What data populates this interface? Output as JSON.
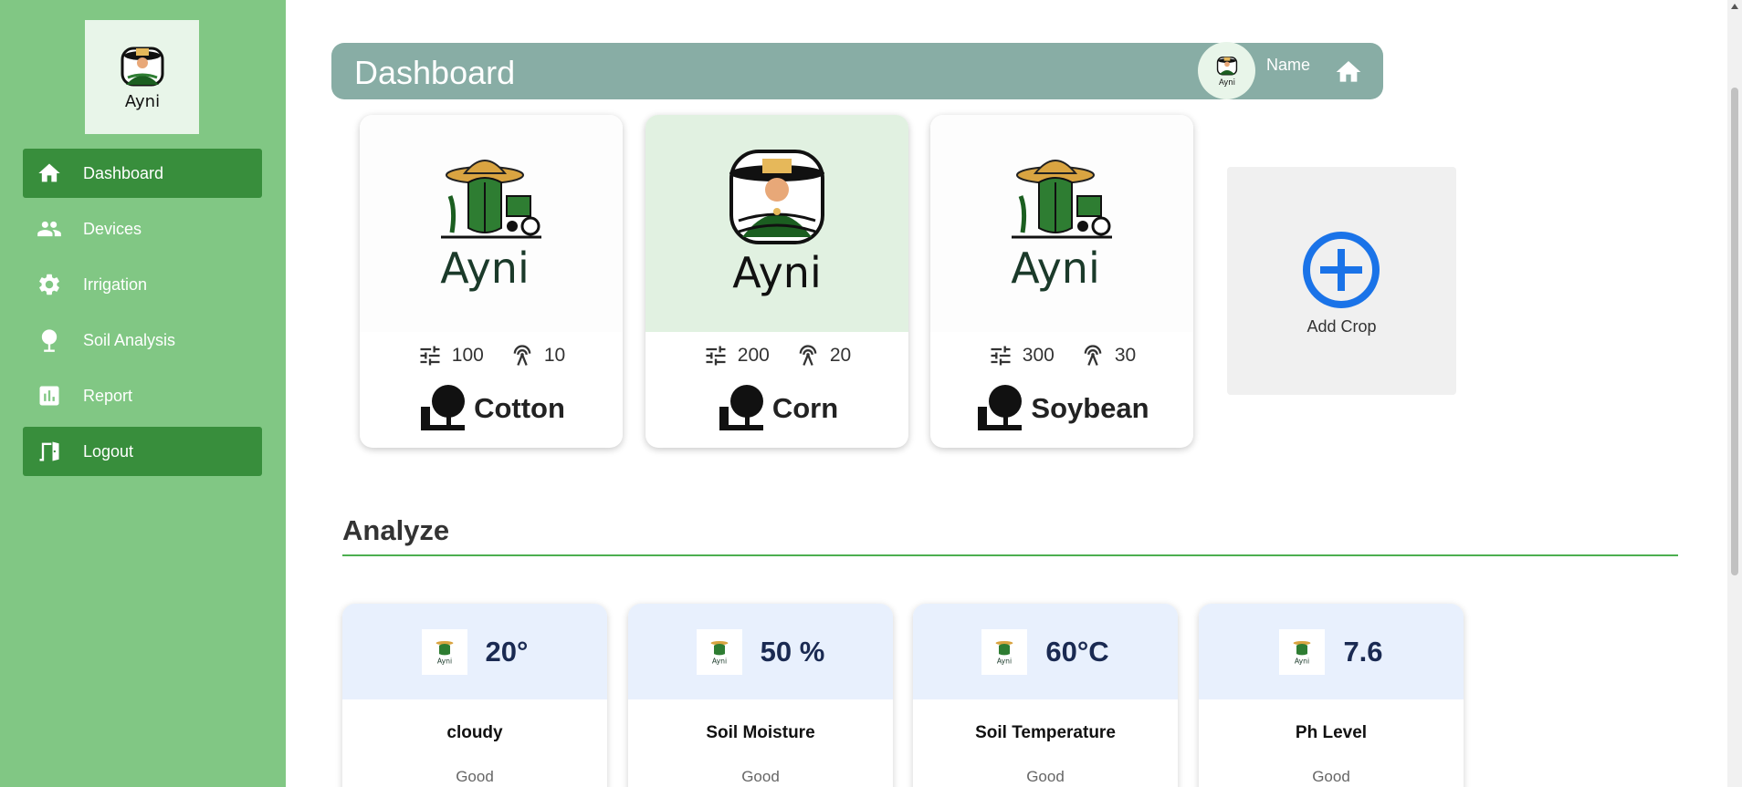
{
  "sidebar": {
    "logo_text": "Ayni",
    "items": [
      {
        "label": "Dashboard",
        "icon": "home-icon",
        "active": true
      },
      {
        "label": "Devices",
        "icon": "people-icon",
        "active": false
      },
      {
        "label": "Irrigation",
        "icon": "gear-icon",
        "active": false
      },
      {
        "label": "Soil Analysis",
        "icon": "tree-icon",
        "active": false
      },
      {
        "label": "Report",
        "icon": "report-icon",
        "active": false
      },
      {
        "label": "Logout",
        "icon": "logout-icon",
        "active": true
      }
    ]
  },
  "header": {
    "title": "Dashboard",
    "user_name": "Name",
    "avatar_text": "Ayni"
  },
  "crops": [
    {
      "name": "Cotton",
      "devices": "100",
      "sensors": "10",
      "logo_text": "Ayni"
    },
    {
      "name": "Corn",
      "devices": "200",
      "sensors": "20",
      "logo_text": "Ayni"
    },
    {
      "name": "Soybean",
      "devices": "300",
      "sensors": "30",
      "logo_text": "Ayni"
    }
  ],
  "add_crop": {
    "label": "Add Crop"
  },
  "analyze": {
    "title": "Analyze",
    "metrics": [
      {
        "value": "20°",
        "label": "cloudy",
        "status": "Good"
      },
      {
        "value": "50 %",
        "label": "Soil Moisture",
        "status": "Good"
      },
      {
        "value": "60°C",
        "label": "Soil Temperature",
        "status": "Good"
      },
      {
        "value": "7.6",
        "label": "Ph Level",
        "status": "Good"
      }
    ]
  },
  "colors": {
    "sidebar_bg": "#81c784",
    "nav_active": "#388e3c",
    "header_bg": "#88ada5",
    "accent_blue": "#1a73e8",
    "metric_value": "#1a2a52"
  }
}
